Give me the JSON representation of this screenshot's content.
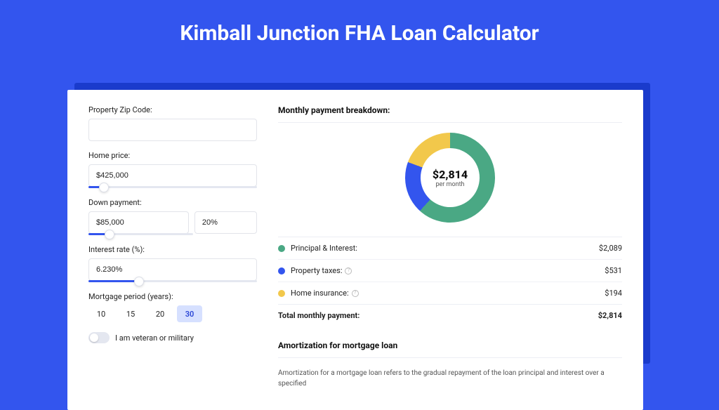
{
  "title": "Kimball Junction FHA Loan Calculator",
  "form": {
    "zip": {
      "label": "Property Zip Code:",
      "value": ""
    },
    "home_price": {
      "label": "Home price:",
      "value": "$425,000",
      "slider_pct": 9
    },
    "down_payment": {
      "label": "Down payment:",
      "amount": "$85,000",
      "pct": "20%",
      "slider_pct": 20
    },
    "interest": {
      "label": "Interest rate (%):",
      "value": "6.230%",
      "slider_pct": 30
    },
    "period": {
      "label": "Mortgage period (years):",
      "options": [
        "10",
        "15",
        "20",
        "30"
      ],
      "active_index": 3
    },
    "veteran": {
      "label": "I am veteran or military",
      "checked": false
    }
  },
  "breakdown": {
    "header": "Monthly payment breakdown:",
    "total_value": "$2,814",
    "total_sub": "per month",
    "items": [
      {
        "color": "#4aa884",
        "label": "Principal & Interest:",
        "value": "$2,089",
        "info": false
      },
      {
        "color": "#3355ee",
        "label": "Property taxes:",
        "value": "$531",
        "info": true
      },
      {
        "color": "#f2c84b",
        "label": "Home insurance:",
        "value": "$194",
        "info": true
      }
    ],
    "total_row": {
      "label": "Total monthly payment:",
      "value": "$2,814"
    }
  },
  "amort": {
    "header": "Amortization for mortgage loan",
    "text": "Amortization for a mortgage loan refers to the gradual repayment of the loan principal and interest over a specified"
  },
  "chart_data": {
    "type": "pie",
    "title": "Monthly payment breakdown",
    "series": [
      {
        "name": "Principal & Interest",
        "value": 2089,
        "color": "#4aa884"
      },
      {
        "name": "Property taxes",
        "value": 531,
        "color": "#3355ee"
      },
      {
        "name": "Home insurance",
        "value": 194,
        "color": "#f2c84b"
      }
    ],
    "total": 2814,
    "center_label": "$2,814 per month"
  }
}
